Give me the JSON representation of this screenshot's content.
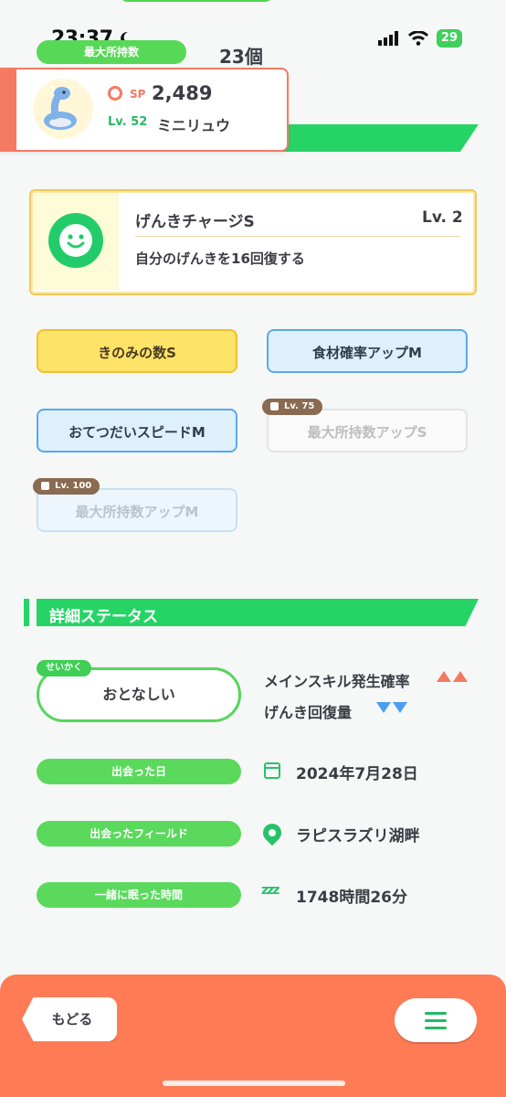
{
  "status_bar": {
    "time": "23:37",
    "battery": "29"
  },
  "header": {
    "max_hold_label": "最大所持数",
    "max_hold_count": "23個"
  },
  "pokemon": {
    "sp_label": "SP",
    "sp_value": "2,489",
    "level": "Lv. 52",
    "name": "ミニリュウ"
  },
  "main_skill": {
    "name": "げんきチャージS",
    "level": "Lv. 2",
    "description": "自分のげんきを16回復する"
  },
  "sub_skills": [
    {
      "label": "きのみの数S"
    },
    {
      "label": "食材確率アップM"
    },
    {
      "label": "おてつだいスピードM"
    },
    {
      "label": "最大所持数アップS",
      "lock": "Lv. 75"
    },
    {
      "label": "最大所持数アップM",
      "lock": "Lv. 100"
    }
  ],
  "details": {
    "section_title": "詳細ステータス",
    "nature_tag": "せいかく",
    "nature": "おとなしい",
    "nature_up": "メインスキル発生確率",
    "nature_down": "げんき回復量",
    "met_date_label": "出会った日",
    "met_date": "2024年7月28日",
    "met_field_label": "出会ったフィールド",
    "met_field": "ラピスラズリ湖畔",
    "slept_label": "一緒に眠った時間",
    "slept_time": "1748時間26分",
    "zzz": "zzz"
  },
  "footer": {
    "back_label": "もどる"
  },
  "colors": {
    "accent_green": "#26d466",
    "accent_orange": "#ff7b55",
    "up_red": "#f47a62",
    "down_blue": "#4a9ef0"
  }
}
